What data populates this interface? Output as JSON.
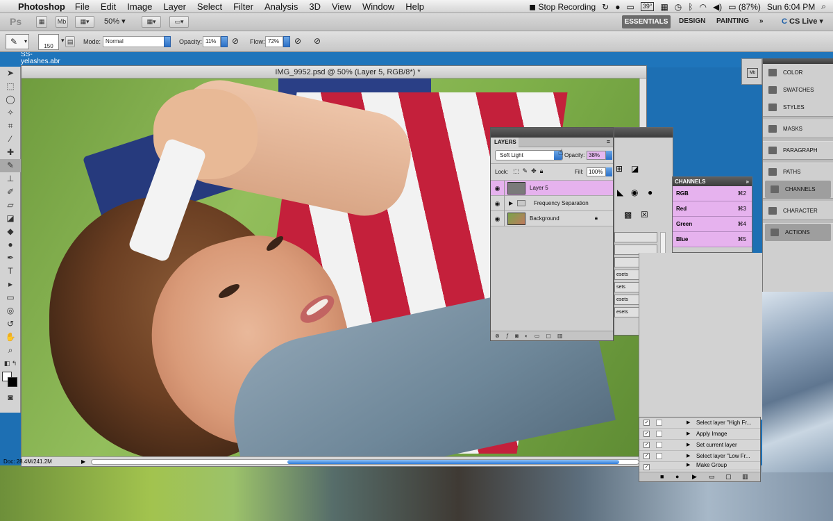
{
  "menubar": {
    "app_name": "Photoshop",
    "items": [
      "File",
      "Edit",
      "Image",
      "Layer",
      "Select",
      "Filter",
      "Analysis",
      "3D",
      "View",
      "Window",
      "Help"
    ],
    "stop_recording": "Stop Recording",
    "badge": "39°",
    "battery": "(87%)",
    "clock": "Sun 6:04 PM"
  },
  "appbar": {
    "logo": "Ps",
    "zoom": "50%",
    "workspaces": [
      "ESSENTIALS",
      "DESIGN",
      "PAINTING"
    ],
    "cs_live": "CS Live"
  },
  "options": {
    "brush_size": "150",
    "mode_label": "Mode:",
    "mode_value": "Normal",
    "opacity_label": "Opacity:",
    "opacity_value": "11%",
    "flow_label": "Flow:",
    "flow_value": "72%"
  },
  "desktop": {
    "label_line1": "SS-",
    "label_line2": "yelashes.abr"
  },
  "document": {
    "title": "IMG_9952.psd @ 50% (Layer 5, RGB/8*) *",
    "status": "Doc: 28.4M/241.2M"
  },
  "layers": {
    "tab": "LAYERS",
    "blend_mode": "Soft Light",
    "opacity_label": "Opacity:",
    "opacity_value": "38%",
    "lock_label": "Lock:",
    "fill_label": "Fill:",
    "fill_value": "100%",
    "items": [
      {
        "name": "Layer 5"
      },
      {
        "name": "Frequency Separation"
      },
      {
        "name": "Background"
      }
    ]
  },
  "channels": {
    "tab": "CHANNELS",
    "items": [
      {
        "name": "RGB",
        "shortcut": "⌘2"
      },
      {
        "name": "Red",
        "shortcut": "⌘3"
      },
      {
        "name": "Green",
        "shortcut": "⌘4"
      },
      {
        "name": "Blue",
        "shortcut": "⌘5"
      }
    ]
  },
  "presets": {
    "items": [
      "esets",
      "sets",
      "esets",
      "esets"
    ]
  },
  "right_dock": {
    "items": [
      "COLOR",
      "SWATCHES",
      "STYLES",
      "MASKS",
      "PARAGRAPH",
      "PATHS",
      "CHANNELS",
      "CHARACTER",
      "ACTIONS"
    ]
  },
  "actions": {
    "items": [
      "Select layer \"High Fr...",
      "Apply Image",
      "Set current layer",
      "Select layer \"Low Fr...",
      "Make Group"
    ]
  },
  "colors": {
    "selection": "#e6b2ee",
    "accent_blue": "#2a6fc6"
  }
}
